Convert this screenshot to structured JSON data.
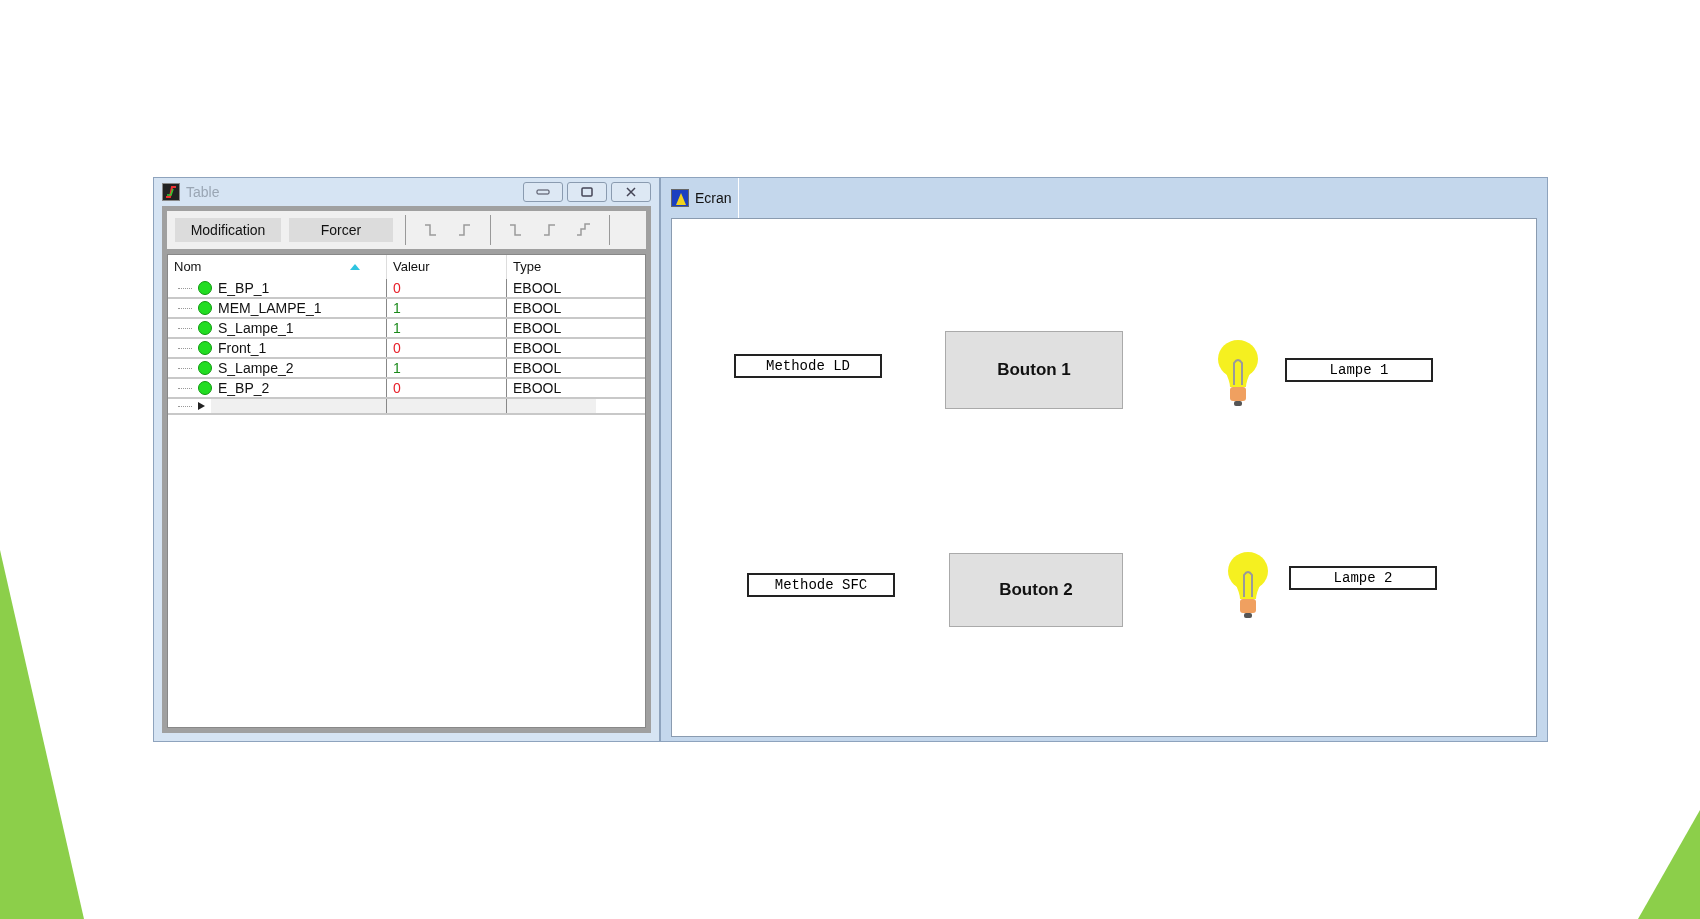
{
  "table_window": {
    "title": "Table",
    "toolbar": {
      "buttons": [
        "Modification",
        "Forcer"
      ]
    },
    "columns": [
      "Nom",
      "Valeur",
      "Type"
    ],
    "rows": [
      {
        "name": "E_BP_1",
        "value": "0",
        "color": "#e8202a",
        "type": "EBOOL"
      },
      {
        "name": "MEM_LAMPE_1",
        "value": "1",
        "color": "#1a8a1a",
        "type": "EBOOL"
      },
      {
        "name": "S_Lampe_1",
        "value": "1",
        "color": "#1a8a1a",
        "type": "EBOOL"
      },
      {
        "name": "Front_1",
        "value": "0",
        "color": "#e8202a",
        "type": "EBOOL"
      },
      {
        "name": "S_Lampe_2",
        "value": "1",
        "color": "#1a8a1a",
        "type": "EBOOL"
      },
      {
        "name": "E_BP_2",
        "value": "0",
        "color": "#e8202a",
        "type": "EBOOL"
      }
    ]
  },
  "screen_window": {
    "title": "Ecran",
    "groups": [
      {
        "method_label": "Methode LD",
        "button": "Bouton 1",
        "lamp_on": true,
        "lamp_label": "Lampe 1"
      },
      {
        "method_label": "Methode SFC",
        "button": "Bouton 2",
        "lamp_on": true,
        "lamp_label": "Lampe 2"
      }
    ]
  }
}
